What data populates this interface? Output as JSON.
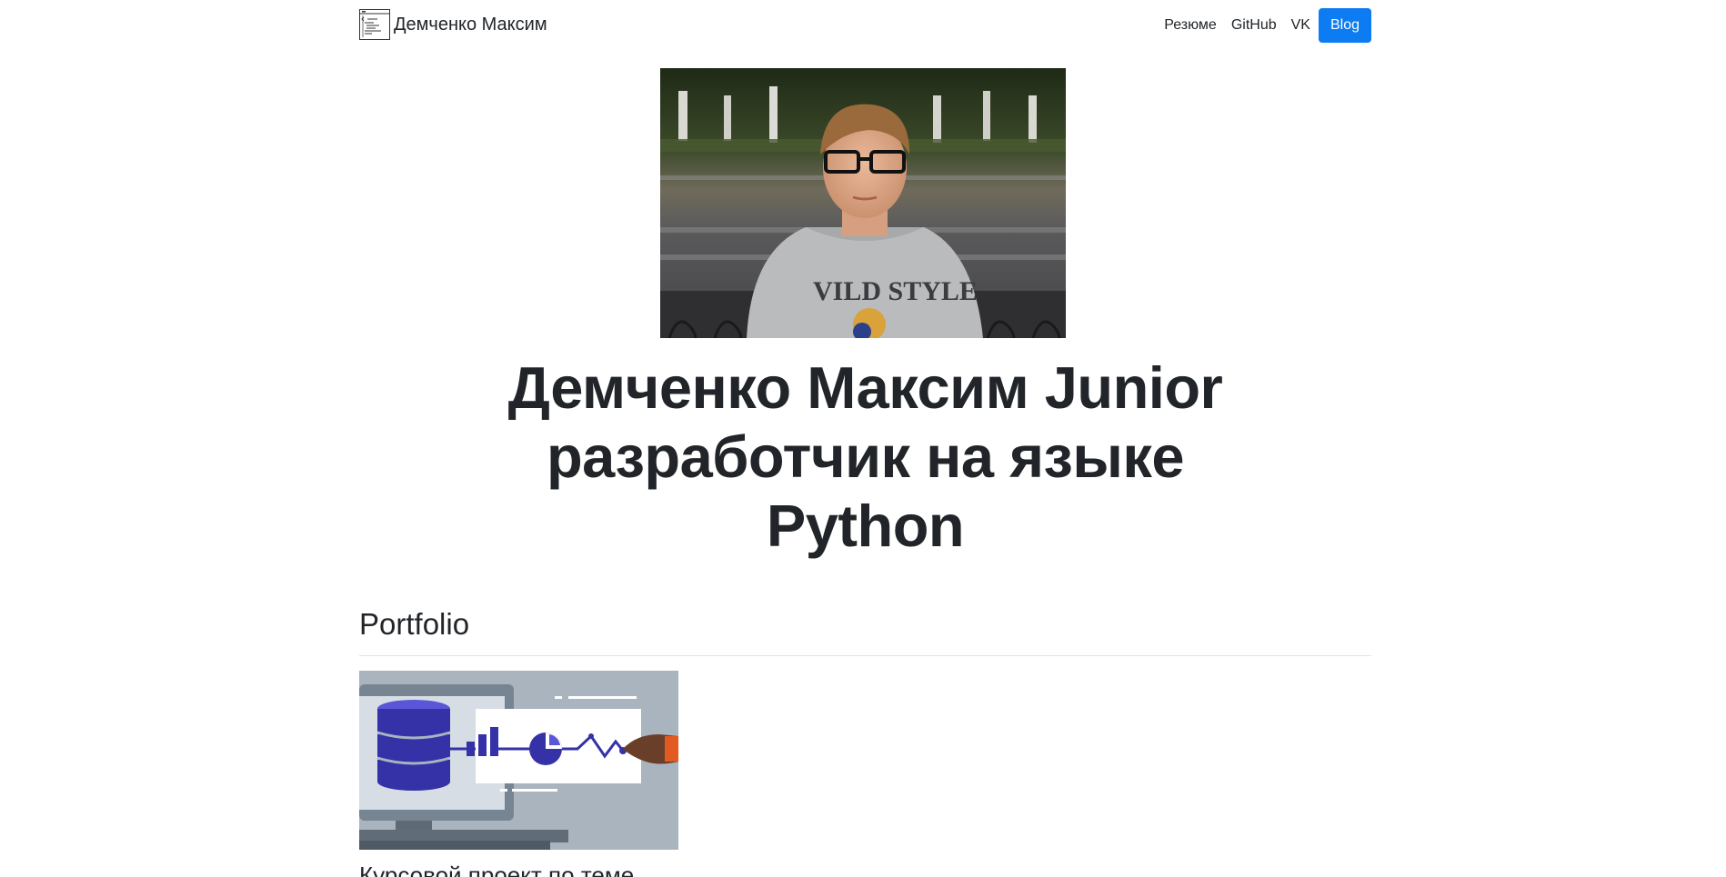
{
  "navbar": {
    "brand_logo_icon": "code-window-icon",
    "brand_name": "Демченко Максим",
    "links": [
      "Резюме",
      "GitHub",
      "VK"
    ],
    "blog_button": "Blog",
    "accent_color": "#0d7cf2"
  },
  "hero": {
    "photo": "portrait-photo",
    "title": "Демченко Максим Junior разработчик на языке Python"
  },
  "portfolio": {
    "heading": "Portfolio",
    "items": [
      {
        "image": "database-analytics-illustration",
        "title": "Курсовой проект по теме"
      }
    ]
  }
}
